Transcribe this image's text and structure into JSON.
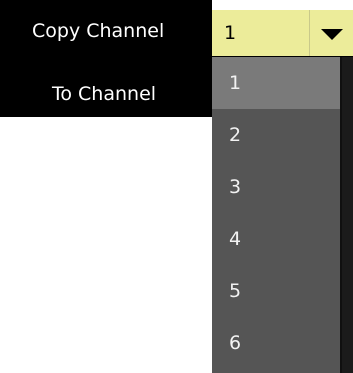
{
  "labels": {
    "copy_channel": "Copy Channel",
    "to_channel": "To Channel"
  },
  "combo": {
    "selected_value": "1"
  },
  "dropdown": {
    "options": [
      "1",
      "2",
      "3",
      "4",
      "5",
      "6"
    ],
    "highlighted_index": 0
  },
  "colors": {
    "combo_background": "#ecec9a",
    "dropdown_background": "#555555",
    "highlight": "#7a7a7a",
    "label_panel": "#000000"
  },
  "icons": {
    "combo_arrow": "triangle-down-icon"
  }
}
